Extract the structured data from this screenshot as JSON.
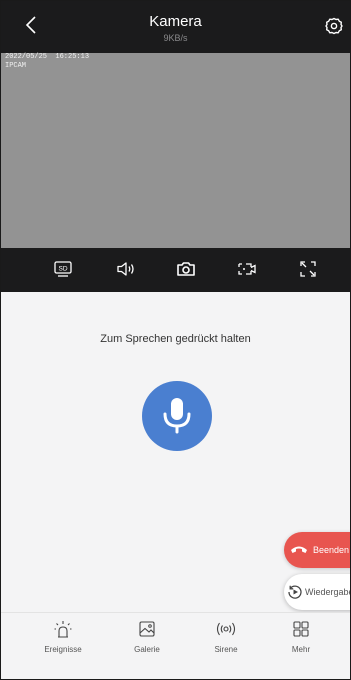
{
  "header": {
    "title": "Kamera",
    "rate": "9KB/s",
    "back_icon": "chevron-left-icon",
    "settings_icon": "gear-icon"
  },
  "video": {
    "timestamp": "2022/05/25  16:25:13",
    "camera_name": "IPCAM"
  },
  "toolbar": {
    "items": [
      {
        "icon": "sd-card-icon",
        "sd_label": "SD"
      },
      {
        "icon": "speaker-icon"
      },
      {
        "icon": "camera-snapshot-icon"
      },
      {
        "icon": "record-video-icon"
      },
      {
        "icon": "fullscreen-icon"
      }
    ]
  },
  "talk": {
    "prompt": "Zum Sprechen gedrückt halten",
    "icon": "microphone-icon",
    "accent": "#4a7fd0"
  },
  "floating": {
    "end_label": "Beenden",
    "end_color": "#e8554f",
    "replay_label": "Wiedergabe"
  },
  "nav": {
    "items": [
      {
        "label": "Ereignisse",
        "icon": "alarm-light-icon"
      },
      {
        "label": "Galerie",
        "icon": "gallery-icon"
      },
      {
        "label": "Sirene",
        "icon": "siren-icon"
      },
      {
        "label": "Mehr",
        "icon": "grid-more-icon"
      }
    ]
  }
}
